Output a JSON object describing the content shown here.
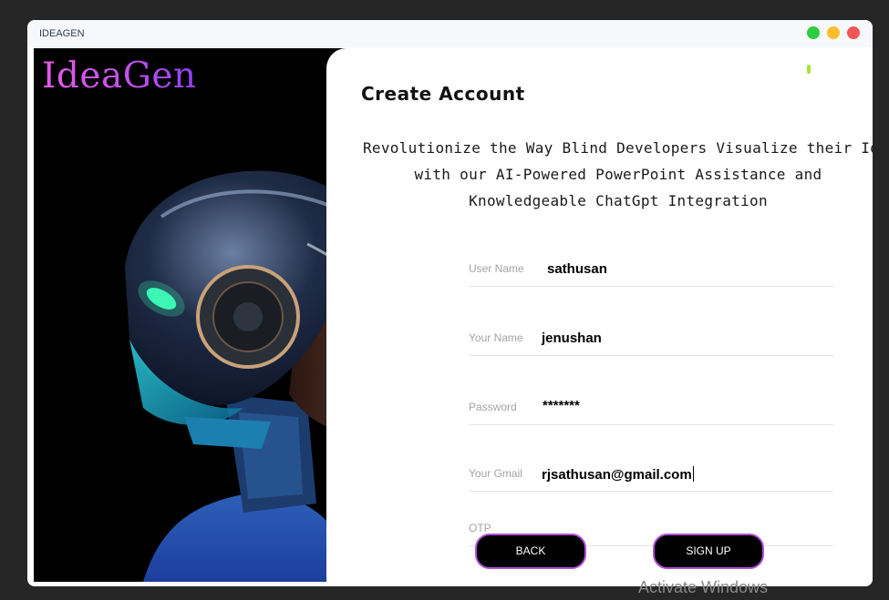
{
  "window": {
    "title": "IDEAGEN"
  },
  "window_controls": [
    "green-dot",
    "yellow-dot",
    "red-dot"
  ],
  "brand": {
    "logo_text": "IdeaGen"
  },
  "form": {
    "heading": "Create Account",
    "tagline": [
      "Revolutionize the Way Blind Developers Visualize their Ideas",
      "with our AI-Powered PowerPoint Assistance and",
      "Knowledgeable ChatGpt Integration"
    ],
    "fields": {
      "username": {
        "label": "User Name",
        "value": "sathusan"
      },
      "your_name": {
        "label": "Your Name",
        "value": "jenushan"
      },
      "password": {
        "label": "Password",
        "value": "*******"
      },
      "gmail": {
        "label": "Your Gmail",
        "value": "rjsathusan@gmail.com"
      },
      "otp": {
        "label": "OTP",
        "value": ""
      }
    },
    "buttons": {
      "back": "BACK",
      "signup": "SIGN UP"
    }
  },
  "system": {
    "watermark": "Activate Windows"
  }
}
